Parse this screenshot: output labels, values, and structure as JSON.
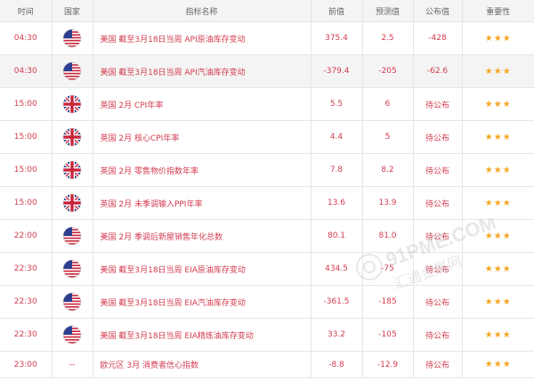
{
  "header": {
    "time": "时间",
    "country": "国家",
    "name": "指标名称",
    "previous": "前值",
    "forecast": "预测值",
    "published": "公布值",
    "importance": "重要性"
  },
  "rows": [
    {
      "time": "04:30",
      "flag": "us",
      "name": "美国 截至3月18日当周 API原油库存变动",
      "previous": "375.4",
      "forecast": "2.5",
      "published": "-428",
      "stars": "★★★"
    },
    {
      "time": "04:30",
      "flag": "us",
      "name": "美国 截至3月18日当周 API汽油库存变动",
      "previous": "-379.4",
      "forecast": "-205",
      "published": "-62.6",
      "stars": "★★★"
    },
    {
      "time": "15:00",
      "flag": "uk",
      "name": "英国 2月 CPI年率",
      "previous": "5.5",
      "forecast": "6",
      "published": "待公布",
      "stars": "★★★"
    },
    {
      "time": "15:00",
      "flag": "uk",
      "name": "英国 2月 核心CPI年率",
      "previous": "4.4",
      "forecast": "5",
      "published": "待公布",
      "stars": "★★★"
    },
    {
      "time": "15:00",
      "flag": "uk",
      "name": "英国 2月 零售物价指数年率",
      "previous": "7.8",
      "forecast": "8.2",
      "published": "待公布",
      "stars": "★★★"
    },
    {
      "time": "15:00",
      "flag": "uk",
      "name": "英国 2月 未季调输入PPI年率",
      "previous": "13.6",
      "forecast": "13.9",
      "published": "待公布",
      "stars": "★★★"
    },
    {
      "time": "22:00",
      "flag": "us",
      "name": "美国 2月 季调后新屋销售年化总数",
      "previous": "80.1",
      "forecast": "81.0",
      "published": "待公布",
      "stars": "★★★"
    },
    {
      "time": "22:30",
      "flag": "us",
      "name": "美国 截至3月18日当周 EIA原油库存变动",
      "previous": "434.5",
      "forecast": "-75",
      "published": "待公布",
      "stars": "★★★"
    },
    {
      "time": "22:30",
      "flag": "us",
      "name": "美国 截至3月18日当周 EIA汽油库存变动",
      "previous": "-361.5",
      "forecast": "-185",
      "published": "待公布",
      "stars": "★★★"
    },
    {
      "time": "22:30",
      "flag": "us",
      "name": "美国 截至3月18日当周 EIA精炼油库存变动",
      "previous": "33.2",
      "forecast": "-105",
      "published": "待公布",
      "stars": "★★★"
    },
    {
      "time": "23:00",
      "flag": "none",
      "country_text": "--",
      "name": "欧元区 3月 消费者信心指数",
      "previous": "-8.8",
      "forecast": "-12.9",
      "published": "待公布",
      "stars": "★★★"
    }
  ],
  "watermark": {
    "text": "91PME.COM",
    "subtext": "汇通金属网"
  },
  "colors": {
    "accent": "#d23c4f",
    "star": "#f5a623",
    "header_bg": "#f4f4f4",
    "border": "#e6e6e6"
  }
}
